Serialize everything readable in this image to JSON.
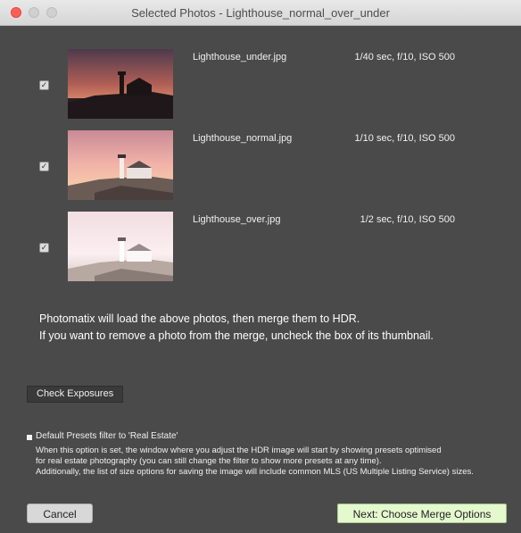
{
  "window": {
    "title": "Selected Photos - Lighthouse_normal_over_under"
  },
  "photos": [
    {
      "filename": "Lighthouse_under.jpg",
      "exposure": "1/40 sec, f/10, ISO 500",
      "checked": true
    },
    {
      "filename": "Lighthouse_normal.jpg",
      "exposure": "1/10 sec, f/10, ISO 500",
      "checked": true
    },
    {
      "filename": "Lighthouse_over.jpg",
      "exposure": "1/2 sec, f/10, ISO 500",
      "checked": true
    }
  ],
  "info": {
    "line1": "Photomatix will load the above photos, then merge them to HDR.",
    "line2": "If you want to remove a photo from the merge, uncheck the box of its thumbnail."
  },
  "check_exposures_label": "Check Exposures",
  "presets_option": {
    "label": "Default Presets filter to 'Real Estate'",
    "checked": true,
    "desc_line1": "When this option is set, the window where you adjust the HDR image will start by showing presets optimised",
    "desc_line2": "for real estate photography (you can still change the filter to show more presets at any time).",
    "desc_line3": "Additionally, the list of size options for saving the image will include common MLS (US Multiple Listing Service) sizes."
  },
  "buttons": {
    "cancel": "Cancel",
    "next": "Next: Choose Merge Options"
  },
  "colors": {
    "background": "#4a4a4a",
    "next_button": "#e5f9cf",
    "close_button": "#ff5f57"
  }
}
